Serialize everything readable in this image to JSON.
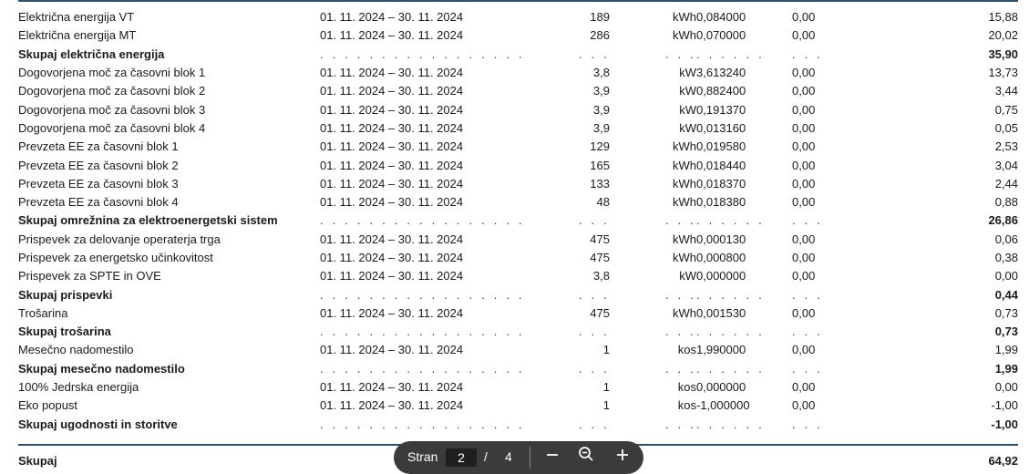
{
  "rows": [
    {
      "desc": "Električna energija VT",
      "period": "01. 11. 2024 – 30. 11. 2024",
      "qty": "189",
      "unit": "kWh",
      "price": "0,084000",
      "disc": "0,00",
      "amount": "15,88"
    },
    {
      "desc": "Električna energija MT",
      "period": "01. 11. 2024 – 30. 11. 2024",
      "qty": "286",
      "unit": "kWh",
      "price": "0,070000",
      "disc": "0,00",
      "amount": "20,02"
    },
    {
      "desc": "Skupaj električna energija",
      "period": ". . . . . . . . . . . . . . . . .",
      "qty": ". . .",
      "unit": ". . .",
      "price": ". . . . . .",
      "disc": ". . .",
      "amount": "35,90",
      "subtotal": true
    },
    {
      "desc": "Dogovorjena moč za časovni blok 1",
      "period": "01. 11. 2024 – 30. 11. 2024",
      "qty": "3,8",
      "unit": "kW",
      "price": "3,613240",
      "disc": "0,00",
      "amount": "13,73"
    },
    {
      "desc": "Dogovorjena moč za časovni blok 2",
      "period": "01. 11. 2024 – 30. 11. 2024",
      "qty": "3,9",
      "unit": "kW",
      "price": "0,882400",
      "disc": "0,00",
      "amount": "3,44"
    },
    {
      "desc": "Dogovorjena moč za časovni blok 3",
      "period": "01. 11. 2024 – 30. 11. 2024",
      "qty": "3,9",
      "unit": "kW",
      "price": "0,191370",
      "disc": "0,00",
      "amount": "0,75"
    },
    {
      "desc": "Dogovorjena moč za časovni blok 4",
      "period": "01. 11. 2024 – 30. 11. 2024",
      "qty": "3,9",
      "unit": "kW",
      "price": "0,013160",
      "disc": "0,00",
      "amount": "0,05"
    },
    {
      "desc": "Prevzeta EE za časovni blok 1",
      "period": "01. 11. 2024 – 30. 11. 2024",
      "qty": "129",
      "unit": "kWh",
      "price": "0,019580",
      "disc": "0,00",
      "amount": "2,53"
    },
    {
      "desc": "Prevzeta EE za časovni blok 2",
      "period": "01. 11. 2024 – 30. 11. 2024",
      "qty": "165",
      "unit": "kWh",
      "price": "0,018440",
      "disc": "0,00",
      "amount": "3,04"
    },
    {
      "desc": "Prevzeta EE za časovni blok 3",
      "period": "01. 11. 2024 – 30. 11. 2024",
      "qty": "133",
      "unit": "kWh",
      "price": "0,018370",
      "disc": "0,00",
      "amount": "2,44"
    },
    {
      "desc": "Prevzeta EE za časovni blok 4",
      "period": "01. 11. 2024 – 30. 11. 2024",
      "qty": "48",
      "unit": "kWh",
      "price": "0,018380",
      "disc": "0,00",
      "amount": "0,88"
    },
    {
      "desc": "Skupaj omrežnina za elektroenergetski sistem",
      "period": ". . . . . . . . . . . . . . . . .",
      "qty": ". . .",
      "unit": ". . .",
      "price": ". . . . . .",
      "disc": ". . .",
      "amount": "26,86",
      "subtotal": true
    },
    {
      "desc": "Prispevek za delovanje operaterja trga",
      "period": "01. 11. 2024 – 30. 11. 2024",
      "qty": "475",
      "unit": "kWh",
      "price": "0,000130",
      "disc": "0,00",
      "amount": "0,06"
    },
    {
      "desc": "Prispevek za energetsko učinkovitost",
      "period": "01. 11. 2024 – 30. 11. 2024",
      "qty": "475",
      "unit": "kWh",
      "price": "0,000800",
      "disc": "0,00",
      "amount": "0,38"
    },
    {
      "desc": "Prispevek za SPTE in OVE",
      "period": "01. 11. 2024 – 30. 11. 2024",
      "qty": "3,8",
      "unit": "kW",
      "price": "0,000000",
      "disc": "0,00",
      "amount": "0,00"
    },
    {
      "desc": "Skupaj prispevki",
      "period": ". . . . . . . . . . . . . . . . .",
      "qty": ". . .",
      "unit": ". . .",
      "price": ". . . . . .",
      "disc": ". . .",
      "amount": "0,44",
      "subtotal": true
    },
    {
      "desc": "Trošarina",
      "period": "01. 11. 2024 – 30. 11. 2024",
      "qty": "475",
      "unit": "kWh",
      "price": "0,001530",
      "disc": "0,00",
      "amount": "0,73"
    },
    {
      "desc": "Skupaj trošarina",
      "period": ". . . . . . . . . . . . . . . . .",
      "qty": ". . .",
      "unit": ". . .",
      "price": ". . . . . .",
      "disc": ". . .",
      "amount": "0,73",
      "subtotal": true
    },
    {
      "desc": "Mesečno nadomestilo",
      "period": "01. 11. 2024 – 30. 11. 2024",
      "qty": "1",
      "unit": "kos",
      "price": "1,990000",
      "disc": "0,00",
      "amount": "1,99"
    },
    {
      "desc": "Skupaj mesečno nadomestilo",
      "period": ". . . . . . . . . . . . . . . . .",
      "qty": ". . .",
      "unit": ". . .",
      "price": ". . . . . .",
      "disc": ". . .",
      "amount": "1,99",
      "subtotal": true
    },
    {
      "desc": "100% Jedrska energija",
      "period": "01. 11. 2024 – 30. 11. 2024",
      "qty": "1",
      "unit": "kos",
      "price": "0,000000",
      "disc": "0,00",
      "amount": "0,00"
    },
    {
      "desc": "Eko popust",
      "period": "01. 11. 2024 – 30. 11. 2024",
      "qty": "1",
      "unit": "kos",
      "price": "-1,000000",
      "disc": "0,00",
      "amount": "-1,00"
    },
    {
      "desc": "Skupaj ugodnosti in storitve",
      "period": ". . . . . . . . . . . . . . . . .",
      "qty": ". . .",
      "unit": ". . .",
      "price": ". . . . . .",
      "disc": ". . .",
      "amount": "-1,00",
      "subtotal": true
    }
  ],
  "grand_total": {
    "label": "Skupaj",
    "value": "64,92"
  },
  "pager": {
    "label": "Stran",
    "current": "2",
    "separator": "/",
    "total": "4",
    "zoom_out_icon": "minus-icon",
    "zoom_icon": "magnifier-minus-icon",
    "zoom_in_icon": "plus-icon"
  }
}
